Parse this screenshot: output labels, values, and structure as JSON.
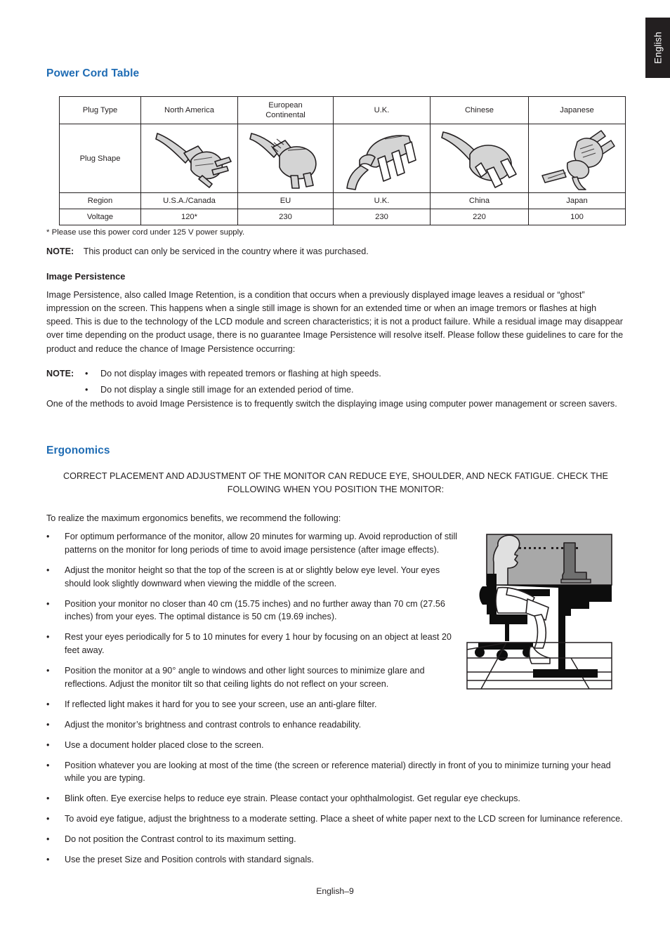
{
  "language_tab": {
    "label": "English"
  },
  "sections": {
    "power_cord": {
      "title": "Power Cord Table",
      "table": {
        "row_labels": [
          "Plug Type",
          "Plug Shape",
          "Region",
          "Voltage"
        ],
        "columns": [
          "North America",
          "European Continental",
          "U.K.",
          "Chinese",
          "Japanese"
        ],
        "plug_icons": [
          "na-plug-icon",
          "eu-plug-icon",
          "uk-plug-icon",
          "cn-plug-icon",
          "jp-plug-icon"
        ],
        "regions": [
          "U.S.A./Canada",
          "EU",
          "U.K.",
          "China",
          "Japan"
        ],
        "voltages": [
          "120*",
          "230",
          "230",
          "220",
          "100"
        ]
      },
      "footnote": "*  Please use this power cord under 125 V power supply.",
      "note_label": "NOTE:",
      "note_text": "This product can only be serviced in the country where it was purchased.",
      "subhead": "Image Persistence",
      "paragraph": "Image Persistence, also called Image Retention, is a condition that occurs when a previously displayed image leaves a residual or “ghost” impression on the screen. This happens when a single still image is shown for an extended time or when an image tremors or flashes at high speed. This is due to the technology of the LCD module and screen characteristics; it is not a product failure. While a residual image may disappear over time depending on the product usage, there is no guarantee Image Persistence will resolve itself. Please follow these guidelines to care for the product and reduce the chance of Image Persistence occurring:",
      "note2_label": "NOTE:",
      "note2_bullets": [
        "Do not display images with repeated tremors or flashing at high speeds.",
        "Do not display a single still image for an extended period of time."
      ],
      "methods_paragraph": "One of the methods to avoid Image Persistence is to frequently switch the displaying image using computer power management or screen savers."
    },
    "ergonomics": {
      "title": "Ergonomics",
      "caption": "CORRECT PLACEMENT AND ADJUSTMENT OF THE MONITOR CAN REDUCE EYE, SHOULDER, AND NECK FATIGUE. CHECK THE FOLLOWING WHEN YOU POSITION THE MONITOR:",
      "intro": "To realize the maximum ergonomics benefits, we recommend the following:",
      "bullets": [
        "For optimum performance of the monitor, allow 20 minutes for warming up. Avoid reproduction of still patterns on the monitor for long periods of time to avoid image persistence (after image effects).",
        "Adjust the monitor height so that the top of the screen is at or slightly below eye level. Your eyes should look slightly downward when viewing the middle of the screen.",
        "Position your monitor no closer than 40 cm (15.75 inches) and no further away than 70 cm (27.56 inches) from your eyes. The optimal distance is 50 cm (19.69 inches).",
        "Rest your eyes periodically for 5 to 10 minutes for every 1 hour by focusing on an object at least 20 feet away.",
        "Position the monitor at a 90° angle to windows and other light sources to minimize glare and reflections. Adjust the monitor tilt so that ceiling lights do not reflect on your screen.",
        "If reflected light makes it hard for you to see your screen, use an anti-glare filter.",
        "Adjust the monitor’s brightness and contrast controls to enhance readability.",
        "Use a document holder placed close to the screen.",
        "Position whatever you are looking at most of the time (the screen or reference material) directly in front of you to minimize turning your head while you are typing.",
        "Blink often. Eye exercise helps to reduce eye strain. Please contact your ophthalmologist. Get regular eye checkups.",
        "To avoid eye fatigue, adjust the brightness to a moderate setting. Place a sheet of white paper next to the LCD screen for luminance reference.",
        "Do not position the Contrast control to its maximum setting.",
        "Use the preset Size and Position controls with standard signals."
      ],
      "figure_name": "ergonomic-workstation-illustration"
    }
  },
  "footer": {
    "page_label": "English–9"
  },
  "bullet_glyph": "•",
  "colors": {
    "heading_blue": "#1f6cb4",
    "text": "#231f20",
    "tab_dark": "#231f20"
  }
}
